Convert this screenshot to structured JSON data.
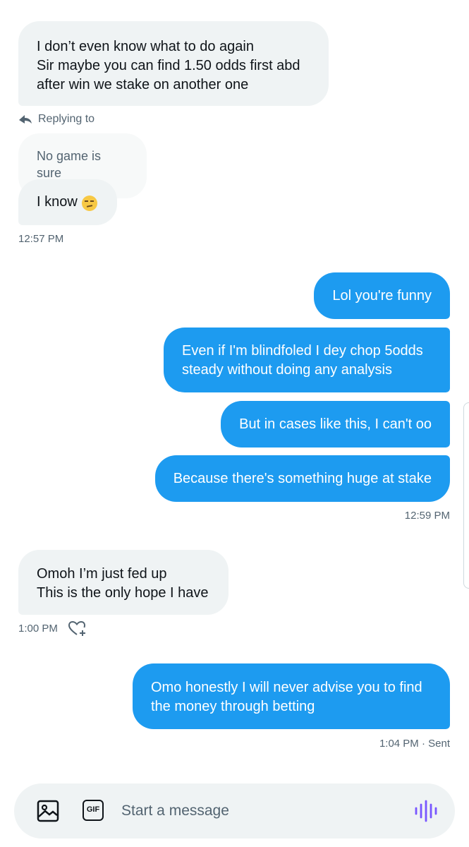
{
  "messages": {
    "received_1": "I don’t even know what to do again\nSir maybe you can find 1.50 odds first abd\nafter win we stake on another one",
    "reply_indicator": "Replying to",
    "quoted_message": "No game is sure",
    "received_2": "I know",
    "received_2_emoji": "unamused-face-emoji",
    "time_1": "12:57 PM",
    "sent_1": "Lol you're funny",
    "sent_2": "Even if I'm blindfoled I dey chop 5odds\nsteady without doing any analysis",
    "sent_3": "But in cases like this, I can't oo",
    "sent_4": "Because there's something huge at stake",
    "time_2": "12:59 PM",
    "received_3": "Omoh I’m just fed up\nThis is the only hope I have",
    "time_3": "1:00 PM",
    "sent_5": "Omo honestly I will never advise you to find\nthe money through betting",
    "time_4": "1:04 PM · Sent"
  },
  "composer": {
    "gif_label": "GIF",
    "placeholder": "Start a message",
    "icons": [
      "image-icon",
      "gif-icon",
      "voice-icon"
    ]
  },
  "colors": {
    "sent_bubble": "#1d9bf0",
    "received_bubble": "#eff3f4",
    "muted_text": "#536471",
    "voice_accent": "#7856ff"
  }
}
